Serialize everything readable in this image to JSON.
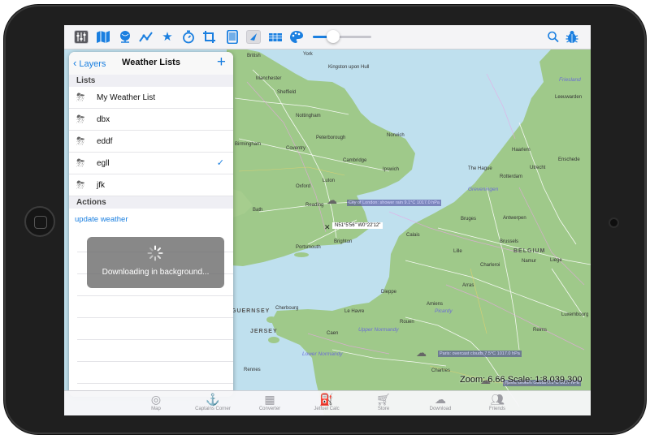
{
  "toolbar": {
    "icons": [
      "sliders-icon",
      "map-icon",
      "globe-icon",
      "route-icon",
      "star-icon",
      "stopwatch-icon",
      "crop-icon",
      "tablet-icon",
      "navigation-icon",
      "layers-icon",
      "palette-icon"
    ],
    "selected_icon": "navigation-icon",
    "slider_value": 0.35,
    "right_icons": [
      "search-icon",
      "bug-icon"
    ]
  },
  "panel": {
    "back_label": "Layers",
    "title": "Weather Lists",
    "add_label": "+",
    "lists_header": "Lists",
    "lists": [
      {
        "label": "My Weather List",
        "checked": false
      },
      {
        "label": "dbx",
        "checked": false
      },
      {
        "label": "eddf",
        "checked": false
      },
      {
        "label": "egll",
        "checked": true
      },
      {
        "label": "jfk",
        "checked": false
      }
    ],
    "actions_header": "Actions",
    "actions": [
      {
        "label": "update weather"
      }
    ]
  },
  "hud": {
    "message": "Downloading in background..."
  },
  "map": {
    "zoom_text": "Zoom: 6.66  Scale: 1:8,039,300",
    "coords_text": "N51°5'56\"  W0°22'12\"",
    "weather_labels": [
      {
        "text": "City of London: shower rain 9.1°C 1017.0 hPa"
      },
      {
        "text": "Paris: overcast clouds 7.5°C 1017.0 hPa"
      },
      {
        "text": "Ypres: broken clouds 8.1°C 1017 hPa"
      }
    ],
    "places": [
      "British",
      "York",
      "Kingston upon Hull",
      "Manchester",
      "Sheffield",
      "Nottingham",
      "Peterborough",
      "Norwich",
      "Coventry",
      "Birmingham",
      "Cambridge",
      "Ipswich",
      "Oxford",
      "Luton",
      "Bath",
      "Reading",
      "Brighton",
      "Portsmouth",
      "Calais",
      "Bruges",
      "Antwerpen",
      "Brussels",
      "Lille",
      "Charleroi",
      "Namur",
      "Liège",
      "Rotterdam",
      "The Hague",
      "Utrecht",
      "Haarlem",
      "Leeuwarden",
      "Enschede",
      "Dieppe",
      "Cherbourg",
      "Caen",
      "Amiens",
      "Rouen",
      "Reims",
      "Luxembourg",
      "Arras",
      "Le Havre",
      "Chartres",
      "Picardy",
      "Rennes"
    ],
    "regions": [
      "GUERNSEY",
      "JERSEY",
      "BELGIUM",
      "Upper Normandy",
      "Lower Normandy",
      "Friesland",
      "Greveningen"
    ]
  },
  "tabs": [
    {
      "label": "Map",
      "icon": "compass-icon"
    },
    {
      "label": "Captains Corner",
      "icon": "ship-icon"
    },
    {
      "label": "Converter",
      "icon": "calculator-icon"
    },
    {
      "label": "Jetfuel Calc",
      "icon": "fuel-icon"
    },
    {
      "label": "Store",
      "icon": "cart-icon"
    },
    {
      "label": "Download",
      "icon": "cloud-download-icon"
    },
    {
      "label": "Friends",
      "icon": "friends-icon"
    }
  ],
  "colors": {
    "accent": "#1a7fe0",
    "sea": "#bfe0ee",
    "land": "#9fc98a"
  }
}
